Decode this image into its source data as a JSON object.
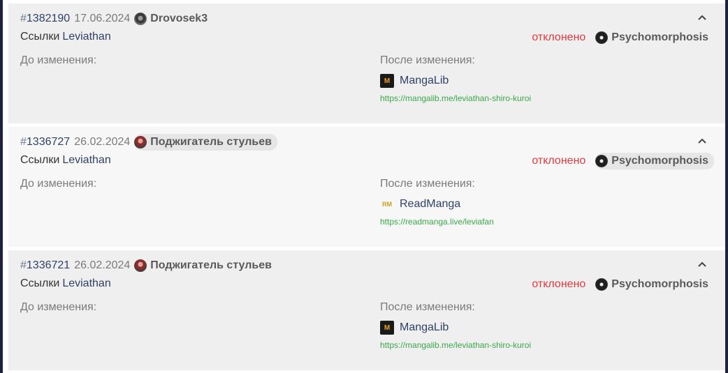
{
  "labels": {
    "before": "До изменения:",
    "after": "После изменения:"
  },
  "colors": {
    "accent_link": "#2f4168",
    "rejected": "#e2383f",
    "url_green": "#3aa84a"
  },
  "entries": [
    {
      "hash": "#",
      "id": "1382190",
      "date": "17.06.2024",
      "author": "Drovosek3",
      "category": "Ссылки",
      "title": "Leviathan",
      "status": "отклонено",
      "moderator": "Psychomorphosis",
      "site_name": "MangaLib",
      "site_icon": "mangalib-favicon",
      "url": "https://mangalib.me/leviathan-shiro-kuroi"
    },
    {
      "hash": "#",
      "id": "1336727",
      "date": "26.02.2024",
      "author": "Поджигатель стульев",
      "category": "Ссылки",
      "title": "Leviathan",
      "status": "отклонено",
      "moderator": "Psychomorphosis",
      "site_name": "ReadManga",
      "site_icon": "readmanga-favicon",
      "url": "https://readmanga.live/leviafan"
    },
    {
      "hash": "#",
      "id": "1336721",
      "date": "26.02.2024",
      "author": "Поджигатель стульев",
      "category": "Ссылки",
      "title": "Leviathan",
      "status": "отклонено",
      "moderator": "Psychomorphosis",
      "site_name": "MangaLib",
      "site_icon": "mangalib-favicon",
      "url": "https://mangalib.me/leviathan-shiro-kuroi"
    }
  ]
}
